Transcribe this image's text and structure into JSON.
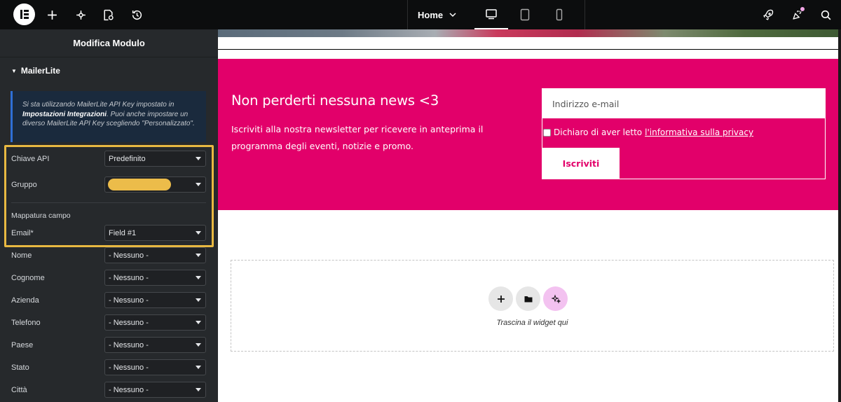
{
  "topbar": {
    "page_name": "Home",
    "icons": [
      "elementor-logo",
      "add-icon",
      "structure-icon",
      "site-settings-icon",
      "history-icon",
      "chevron-down-icon",
      "desktop-icon",
      "tablet-icon",
      "mobile-icon",
      "rocket-icon",
      "whats-new-icon",
      "search-icon"
    ]
  },
  "sidebar": {
    "title": "Modifica Modulo",
    "section_title": "MailerLite",
    "notice": {
      "part1": "Si sta utilizzando MailerLite API Key impostato in ",
      "bold": "Impostazioni Integrazioni",
      "part2": ". Puoi anche impostare un diverso MailerLite API Key scegliendo \"Personalizzato\"."
    },
    "api_key": {
      "label": "Chiave API",
      "value": "Predefinito"
    },
    "group": {
      "label": "Gruppo",
      "value": ""
    },
    "field_mapping_label": "Mappatura campo",
    "fields": [
      {
        "label": "Email*",
        "value": "Field #1"
      },
      {
        "label": "Nome",
        "value": "- Nessuno -"
      },
      {
        "label": "Cognome",
        "value": "- Nessuno -"
      },
      {
        "label": "Azienda",
        "value": "- Nessuno -"
      },
      {
        "label": "Telefono",
        "value": "- Nessuno -"
      },
      {
        "label": "Paese",
        "value": "- Nessuno -"
      },
      {
        "label": "Stato",
        "value": "- Nessuno -"
      },
      {
        "label": "Città",
        "value": "- Nessuno -"
      }
    ],
    "highlight_color": "#e8b841"
  },
  "newsletter": {
    "title": "Non perderti nessuna news <3",
    "description": "Iscriviti alla nostra newsletter per ricevere in anteprima il programma degli eventi, notizie e promo.",
    "email_placeholder": "Indirizzo e-mail",
    "privacy_text": "Dichiaro di aver letto",
    "privacy_link": "l'informativa sulla privacy",
    "submit_label": "Iscriviti",
    "brand_color": "#e2006a"
  },
  "dropzone": {
    "hint": "Trascina il widget qui"
  }
}
